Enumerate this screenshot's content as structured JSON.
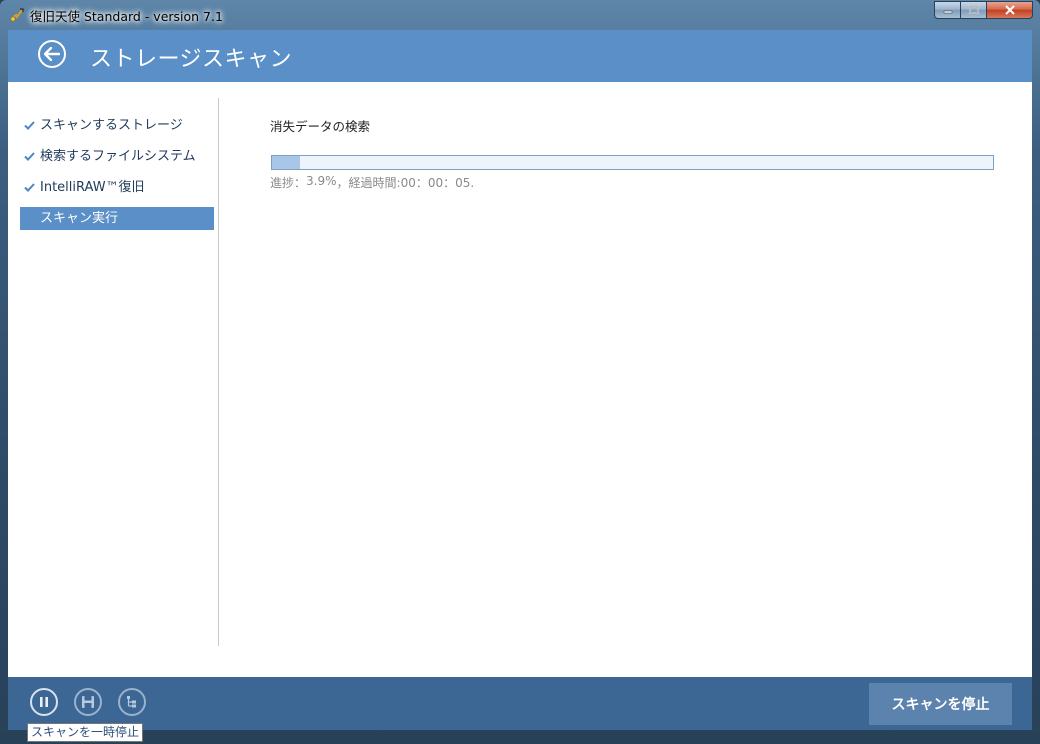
{
  "window": {
    "title": "復旧天使 Standard - version 7.1"
  },
  "header": {
    "title": "ストレージスキャン"
  },
  "sidebar": {
    "items": [
      {
        "label": "スキャンするストレージ",
        "done": true
      },
      {
        "label": "検索するファイルシステム",
        "done": true
      },
      {
        "label": "IntelliRAW™復旧",
        "done": true
      },
      {
        "label": "スキャン実行",
        "done": false,
        "active": true
      }
    ]
  },
  "main": {
    "section_label": "消失データの検索",
    "progress_value": 3.9,
    "status": {
      "progress_prefix": "進捗：",
      "progress_text": "3.9%",
      "separator": "，",
      "elapsed_prefix": "経過時間: ",
      "elapsed_text": "00：00：05."
    }
  },
  "footer": {
    "icons": [
      "pause-icon",
      "save-icon",
      "tree-view-icon"
    ],
    "stop_button": "スキャンを停止",
    "tooltip": "スキャンを一時停止"
  },
  "colors": {
    "accent": "#5a8fc8",
    "footer": "#3c6693",
    "stop_button": "#5b83ad",
    "progress_fill": "#a8c6e8"
  }
}
